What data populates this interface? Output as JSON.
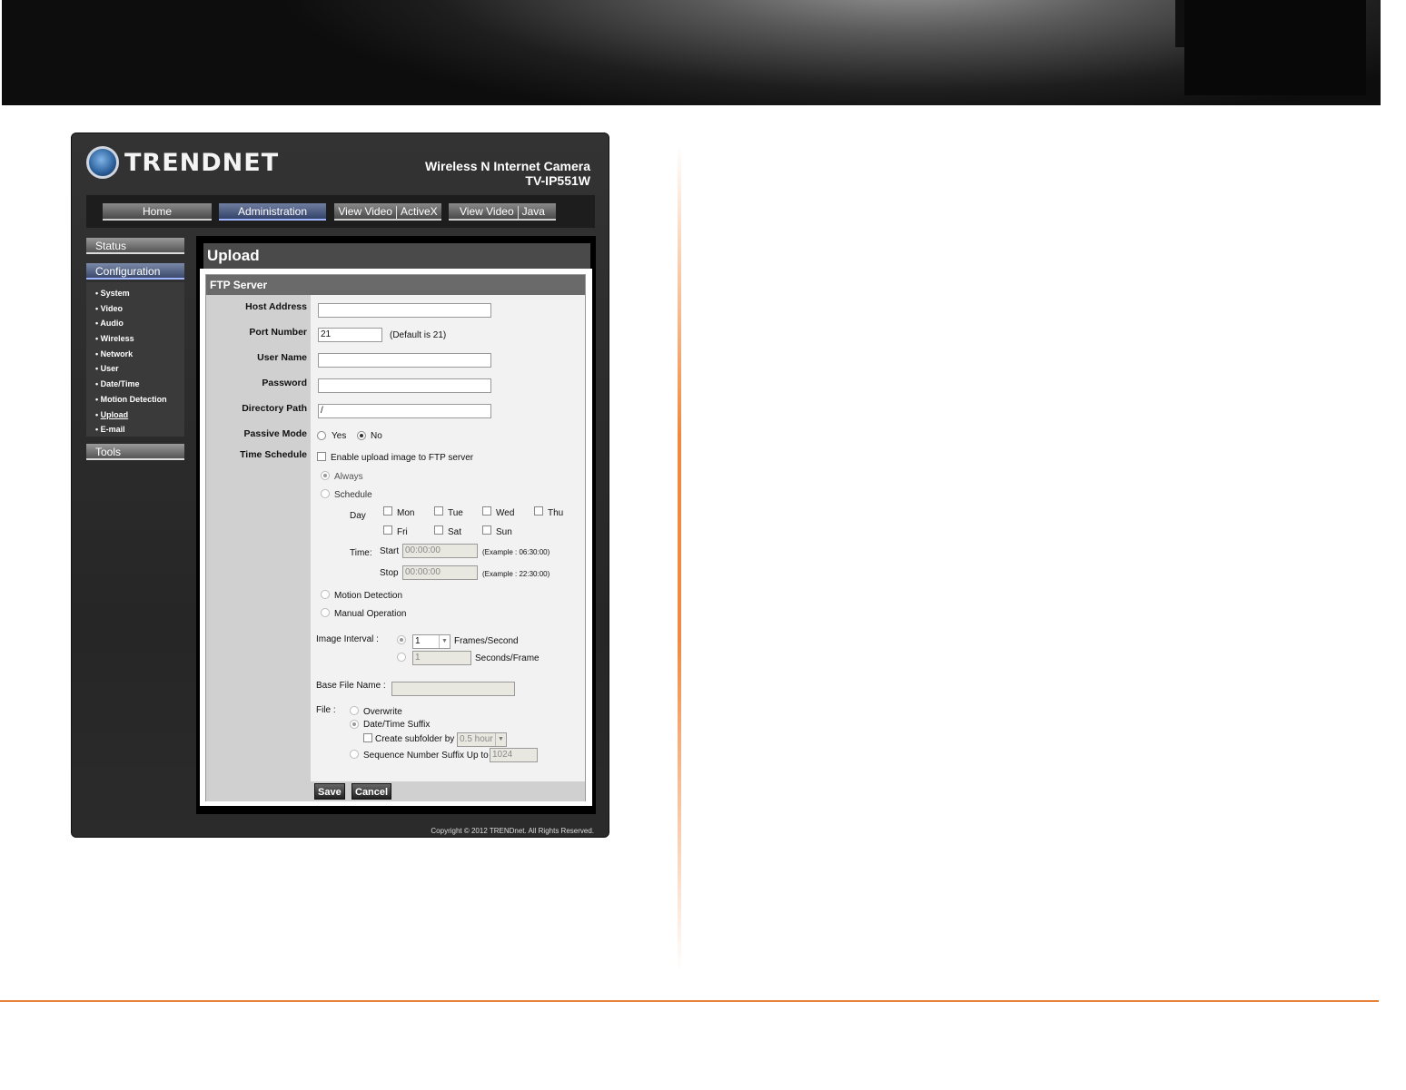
{
  "camera": {
    "brand": "TRENDNET",
    "product_line1": "Wireless N Internet Camera",
    "product_line2": "TV-IP551W",
    "nav": {
      "home": "Home",
      "administration": "Administration",
      "view_video": "View Video",
      "activex": "ActiveX",
      "view_video2": "View Video",
      "java": "Java"
    },
    "menu": {
      "status": "Status",
      "configuration": "Configuration",
      "tools": "Tools",
      "items": [
        "System",
        "Video",
        "Audio",
        "Wireless",
        "Network",
        "User",
        "Date/Time",
        "Motion Detection",
        "Upload",
        "E-mail"
      ]
    },
    "page_title": "Upload",
    "section_title": "FTP Server",
    "fields": {
      "host_address": {
        "label": "Host Address",
        "value": ""
      },
      "port_number": {
        "label": "Port Number",
        "value": "21",
        "hint": "(Default is 21)"
      },
      "user_name": {
        "label": "User Name",
        "value": ""
      },
      "password": {
        "label": "Password",
        "value": ""
      },
      "directory_path": {
        "label": "Directory Path",
        "value": "/"
      },
      "passive_mode": {
        "label": "Passive Mode",
        "yes": "Yes",
        "no": "No",
        "selected": "No"
      },
      "time_schedule": {
        "label": "Time Schedule",
        "enable": "Enable upload image to FTP server",
        "always": "Always",
        "schedule": "Schedule",
        "day_label": "Day",
        "days": [
          "Mon",
          "Tue",
          "Wed",
          "Thu",
          "Fri",
          "Sat",
          "Sun"
        ],
        "time_label": "Time:",
        "start_label": "Start",
        "start_value": "00:00:00",
        "start_example": "(Example : 06:30:00)",
        "stop_label": "Stop",
        "stop_value": "00:00:00",
        "stop_example": "(Example : 22:30:00)",
        "motion_detection": "Motion Detection",
        "manual_operation": "Manual Operation",
        "image_interval_label": "Image Interval :",
        "frames_value": "1",
        "frames_unit": "Frames/Second",
        "seconds_value": "1",
        "seconds_unit": "Seconds/Frame",
        "base_file_name_label": "Base File Name :",
        "base_file_name_value": "",
        "file_label": "File :",
        "overwrite": "Overwrite",
        "datetime_suffix": "Date/Time Suffix",
        "create_subfolder": "Create subfolder by",
        "subfolder_value": "0.5 hour",
        "sequence_suffix": "Sequence Number Suffix Up to",
        "sequence_value": "1024"
      }
    },
    "buttons": {
      "save": "Save",
      "cancel": "Cancel"
    },
    "copyright": "Copyright © 2012 TRENDnet.  All Rights Reserved."
  }
}
